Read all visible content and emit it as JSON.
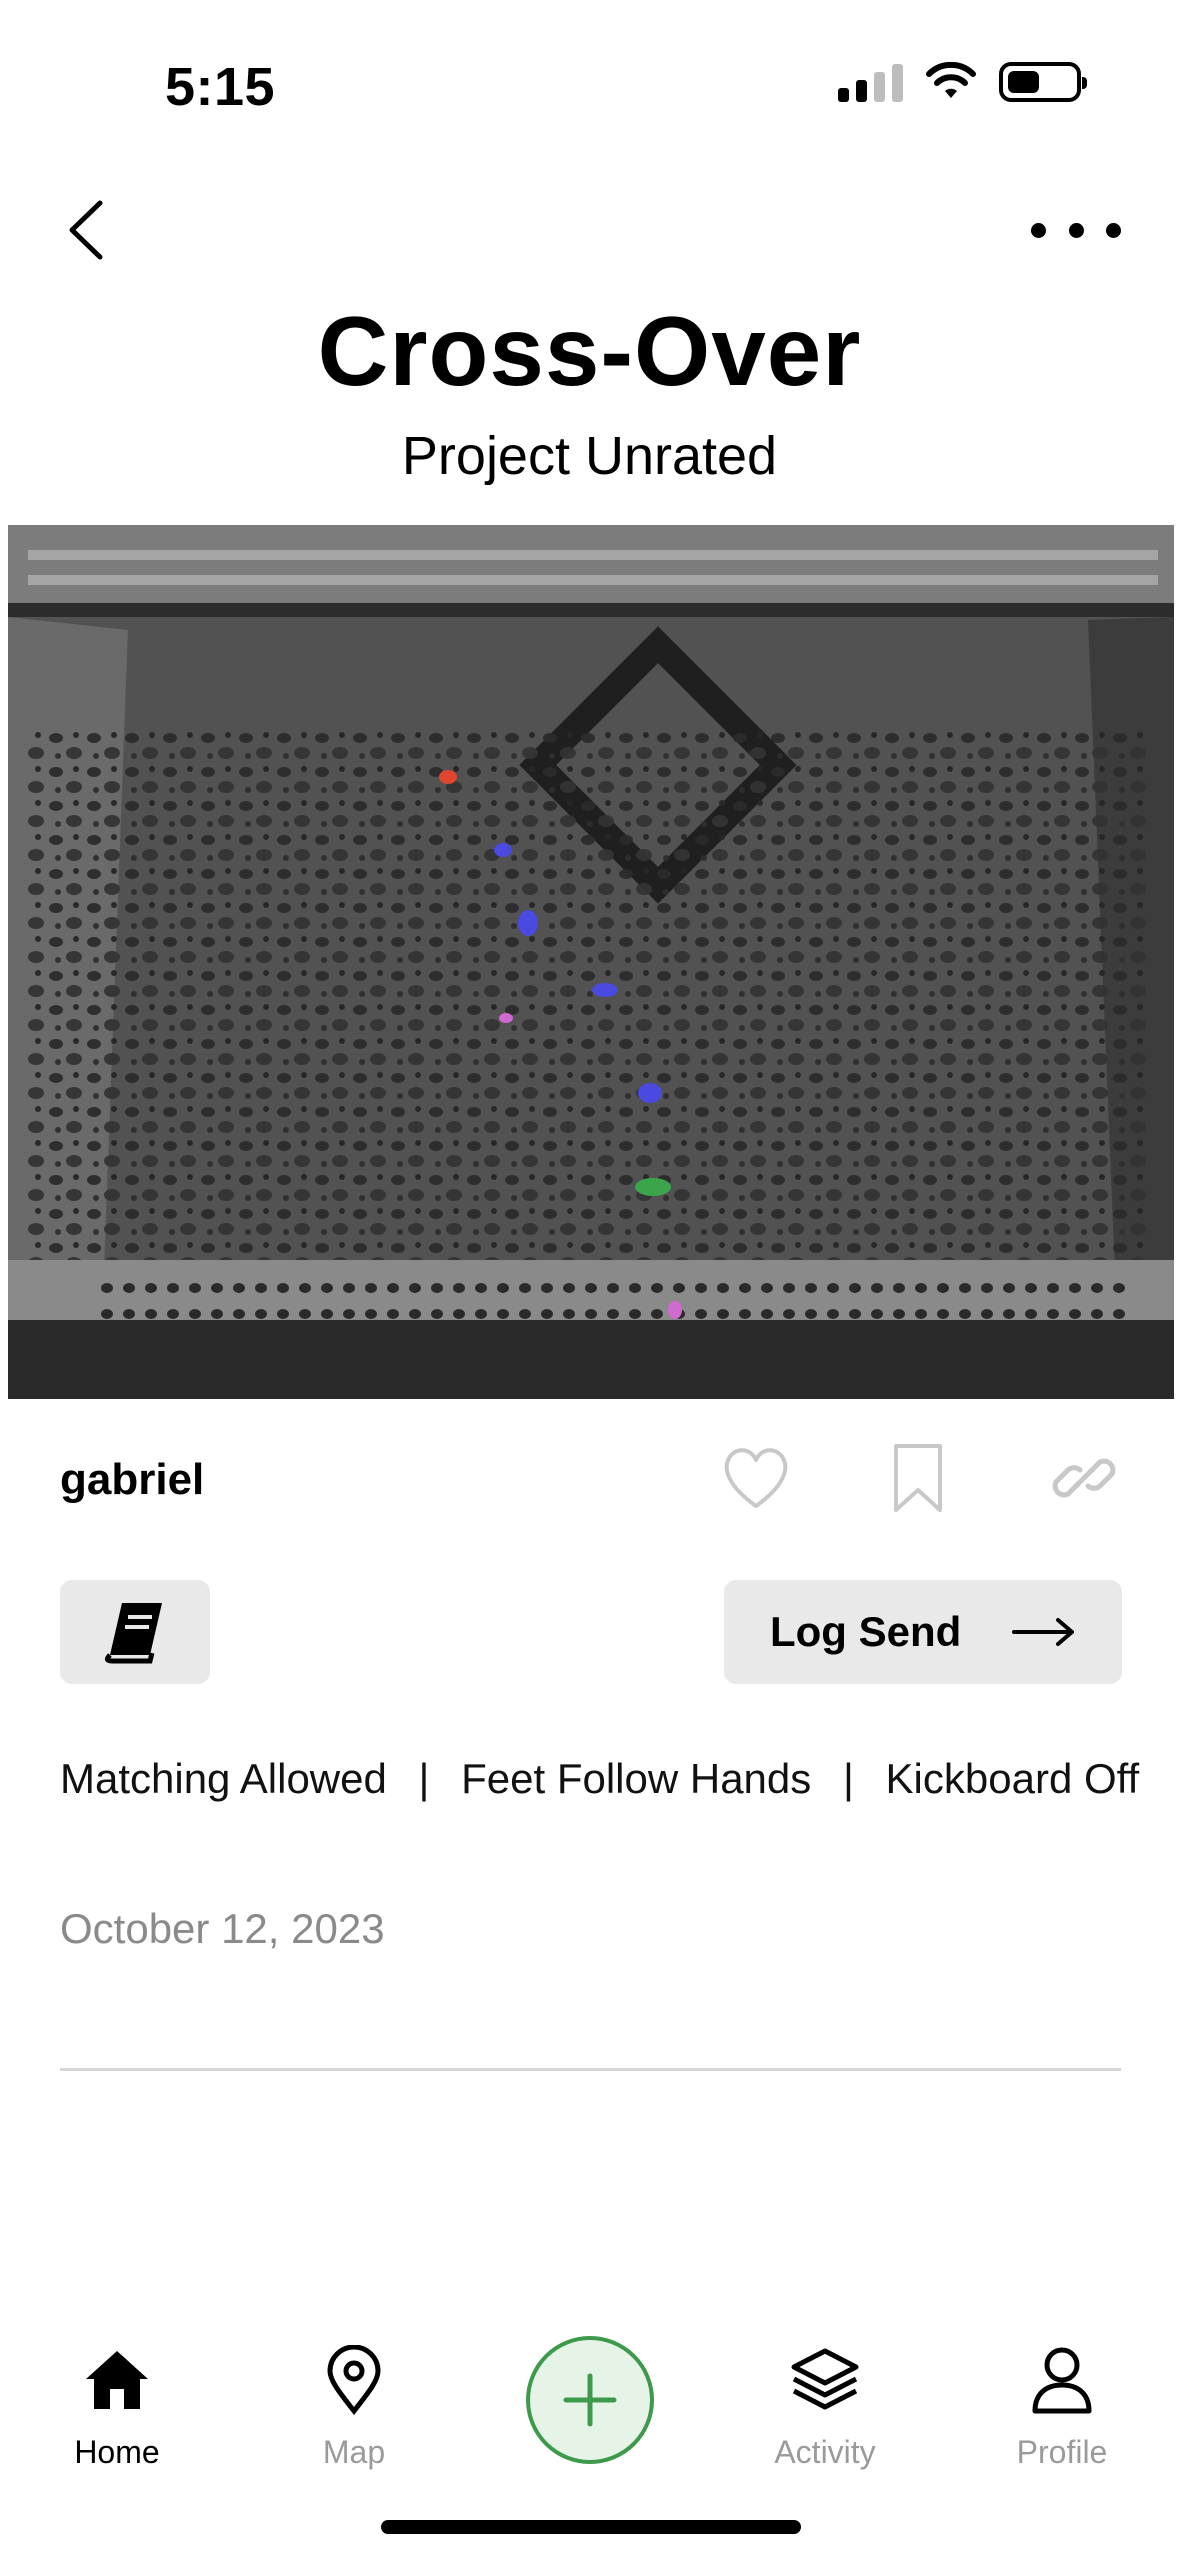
{
  "status_bar": {
    "time": "5:15"
  },
  "header": {
    "title": "Cross-Over",
    "subtitle": "Project Unrated"
  },
  "post": {
    "author": "gabriel",
    "log_button_label": "Log Send",
    "rules": [
      "Matching Allowed",
      "Feet Follow Hands",
      "Kickboard Off"
    ],
    "rule_separator": "|",
    "date": "October 12, 2023"
  },
  "hold_colors": {
    "start": "#3aa54a",
    "hand": "#4a4ae0",
    "foot": "#d06ad0",
    "finish": "#e0452e"
  },
  "accent_color": "#3d9a4a",
  "tab_bar": {
    "items": [
      {
        "label": "Home",
        "icon": "home-icon",
        "active": true
      },
      {
        "label": "Map",
        "icon": "map-pin-icon",
        "active": false
      },
      {
        "label": "Activity",
        "icon": "layers-icon",
        "active": false
      },
      {
        "label": "Profile",
        "icon": "person-icon",
        "active": false
      }
    ],
    "center_action": "plus-icon"
  }
}
